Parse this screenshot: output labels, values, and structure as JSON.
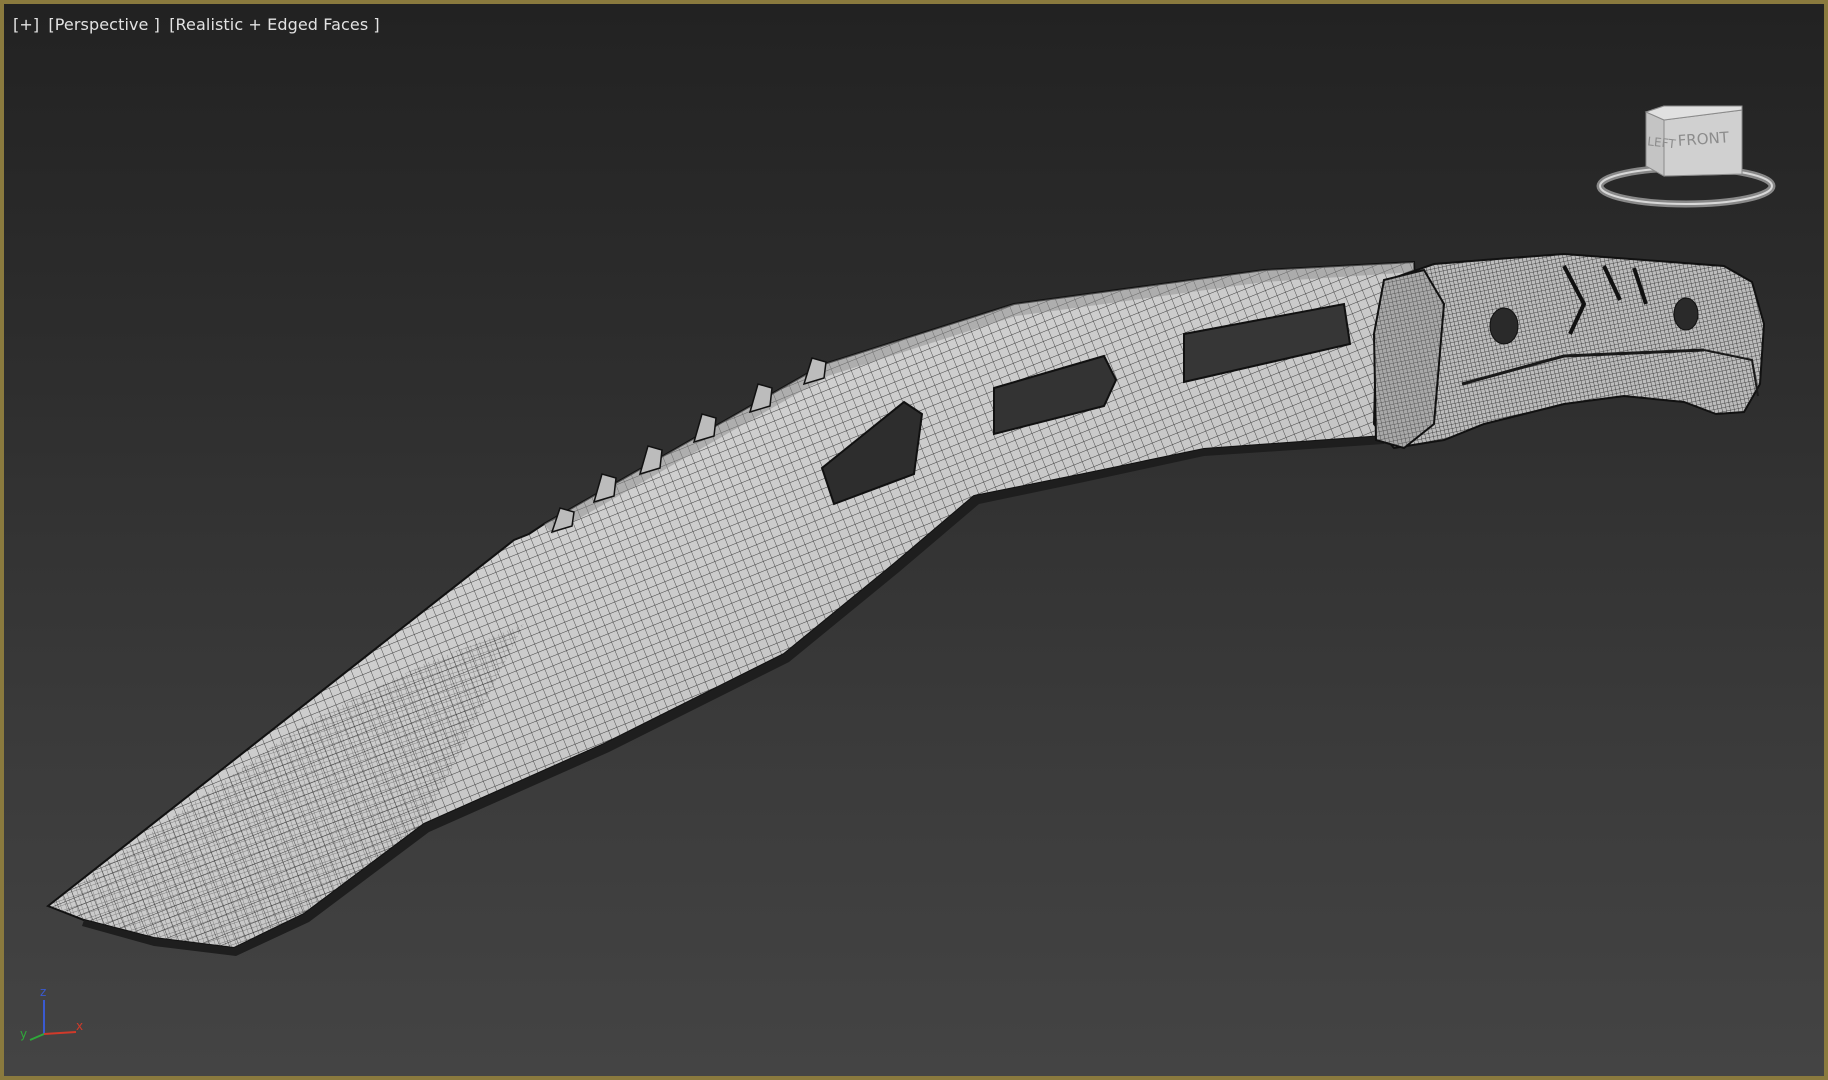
{
  "viewport": {
    "labels": {
      "menu": "[+]",
      "view": "[Perspective ]",
      "shading": "[Realistic + Edged Faces ]"
    },
    "border_color": "#8a7a3e",
    "background_top": "#222222",
    "background_bottom": "#444444"
  },
  "viewcube": {
    "left_face": "LEFT",
    "front_face": "FRONT"
  },
  "axis_gizmo": {
    "x": "x",
    "y": "y",
    "z": "z",
    "colors": {
      "x": "#d03a2a",
      "y": "#2fa83a",
      "z": "#3a5ad0"
    }
  },
  "model": {
    "description_icon": "kukri-knife-wireframe",
    "mesh_color": "#c8c8c8",
    "wire_color": "#1a1a1a"
  }
}
